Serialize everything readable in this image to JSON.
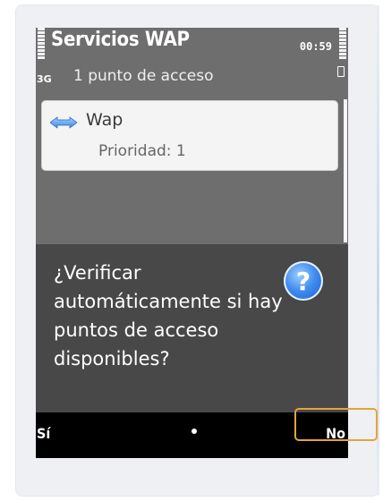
{
  "status_bar": {
    "title": "Servicios WAP",
    "time": "00:59",
    "network": "3G",
    "subtitle": "1 punto de acceso"
  },
  "list": {
    "items": [
      {
        "name": "Wap",
        "detail": "Prioridad: 1",
        "icon": "access-point-arrows-icon"
      }
    ]
  },
  "dialog": {
    "message": "¿Verificar automáticamente si hay puntos de acceso disponibles?",
    "icon": "question-icon",
    "icon_glyph": "?"
  },
  "softkeys": {
    "left": "Sí",
    "right": "No"
  },
  "colors": {
    "screen_bg": "#6e6e6e",
    "dialog_bg": "#484848",
    "softkey_bg": "#000000",
    "highlight": "#e6a23c",
    "question_icon": "#3f8cf0"
  }
}
